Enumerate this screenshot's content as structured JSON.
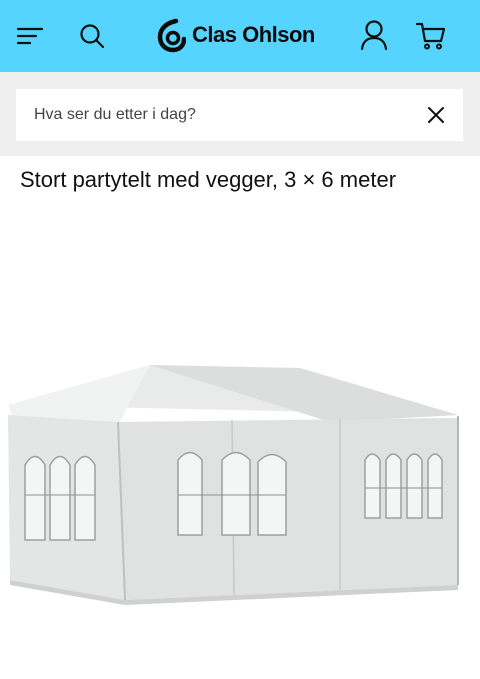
{
  "header": {
    "background": "#55d4ff",
    "logo_text": "Clas Ohlson",
    "icons": [
      "menu-icon",
      "search-icon",
      "account-icon",
      "cart-icon"
    ]
  },
  "search": {
    "placeholder": "Hva ser du etter i dag?",
    "value": "",
    "clear_icon": "close-icon"
  },
  "product": {
    "title": "Stort partytelt med vegger, 3 × 6 meter",
    "image_alt": "Stort partytelt med vegger"
  }
}
